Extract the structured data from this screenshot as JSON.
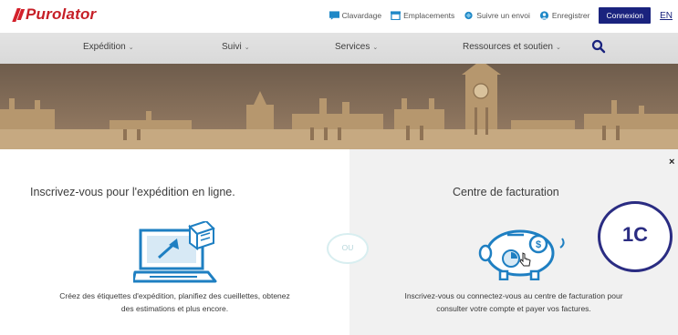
{
  "brand": {
    "name": "Purolator",
    "color": "#c61f27"
  },
  "utility_nav": {
    "items": [
      {
        "label": "Clavardage",
        "icon": "chat-icon"
      },
      {
        "label": "Emplacements",
        "icon": "store-icon"
      },
      {
        "label": "Suivre un envoi",
        "icon": "track-icon"
      },
      {
        "label": "Enregistrer",
        "icon": "user-icon"
      }
    ],
    "login_label": "Connexion",
    "language_label": "EN"
  },
  "main_nav": {
    "items": [
      {
        "label": "Expédition"
      },
      {
        "label": "Suivi"
      },
      {
        "label": "Services"
      },
      {
        "label": "Ressources et soutien"
      }
    ]
  },
  "left_panel": {
    "title": "Inscrivez-vous pour l'expédition en ligne.",
    "description_line1": "Créez des étiquettes d'expédition, planifiez des cueillettes, obtenez",
    "description_line2": "des estimations et plus encore."
  },
  "right_panel": {
    "title": "Centre de facturation",
    "description_line1": "Inscrivez-vous ou connectez-vous au centre de facturation pour",
    "description_line2": "consulter votre compte et payer vos factures."
  },
  "divider_label": "OU",
  "annotation_badge": "1C",
  "colors": {
    "navy": "#1a237e",
    "accent_blue": "#1e7fc2",
    "badge": "#2a2c82"
  }
}
